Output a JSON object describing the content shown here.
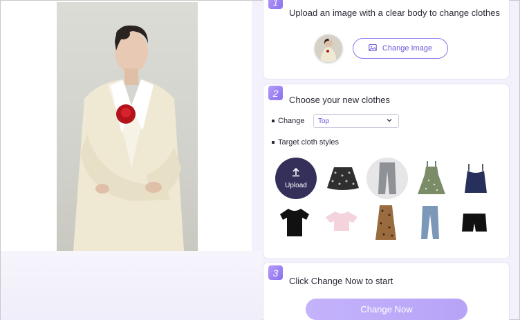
{
  "steps": [
    {
      "number": "1",
      "title": "Upload an image with a clear body to change clothes"
    },
    {
      "number": "2",
      "title": "Choose your new clothes"
    },
    {
      "number": "3",
      "title": "Click Change Now to start"
    }
  ],
  "step1": {
    "change_image_label": "Change Image",
    "icon": "image-icon"
  },
  "step2": {
    "change_label": "Change",
    "selected_type": "Top",
    "target_label": "Target cloth styles",
    "upload_label": "Upload",
    "styles": [
      {
        "name": "upload",
        "icon": "upload-icon"
      },
      {
        "name": "floral-skirt"
      },
      {
        "name": "grey-jeans"
      },
      {
        "name": "floral-dress"
      },
      {
        "name": "navy-tank-top"
      },
      {
        "name": "black-tshirt"
      },
      {
        "name": "pink-crop-top"
      },
      {
        "name": "leopard-dress"
      },
      {
        "name": "blue-jeans"
      },
      {
        "name": "black-shorts"
      }
    ]
  },
  "step3": {
    "change_now_label": "Change Now"
  },
  "colors": {
    "accent": "#8b74ee",
    "upload_bg": "#35305a",
    "button": "#c4b3fb"
  }
}
